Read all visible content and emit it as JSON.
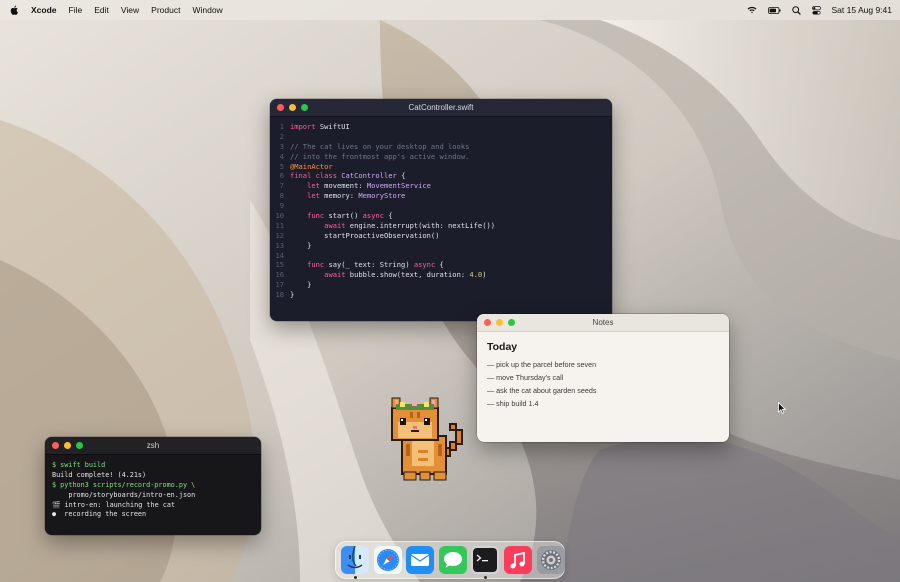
{
  "menubar": {
    "app_name": "Xcode",
    "items": [
      "File",
      "Edit",
      "View",
      "Product",
      "Window"
    ],
    "clock": "Sat 15 Aug 9:41",
    "status_icons": [
      "wifi-icon",
      "battery-icon",
      "search-icon",
      "control-center-icon"
    ]
  },
  "editor": {
    "title": "CatController.swift",
    "lines": [
      {
        "n": "1",
        "tokens": [
          [
            "kw",
            "import"
          ],
          [
            "tx",
            " SwiftUI"
          ]
        ]
      },
      {
        "n": "2",
        "tokens": []
      },
      {
        "n": "3",
        "tokens": [
          [
            "cm",
            "// The cat lives on your desktop and looks"
          ]
        ]
      },
      {
        "n": "4",
        "tokens": [
          [
            "cm",
            "// into the frontmost app's active window."
          ]
        ]
      },
      {
        "n": "5",
        "tokens": [
          [
            "at",
            "@MainActor"
          ]
        ]
      },
      {
        "n": "6",
        "tokens": [
          [
            "kw",
            "final class"
          ],
          [
            "tx",
            " "
          ],
          [
            "ty",
            "CatController"
          ],
          [
            "tx",
            " {"
          ]
        ]
      },
      {
        "n": "7",
        "tokens": [
          [
            "tx",
            "    "
          ],
          [
            "kw",
            "let"
          ],
          [
            "tx",
            " movement: "
          ],
          [
            "ty",
            "MovementService"
          ]
        ]
      },
      {
        "n": "8",
        "tokens": [
          [
            "tx",
            "    "
          ],
          [
            "kw",
            "let"
          ],
          [
            "tx",
            " memory: "
          ],
          [
            "ty",
            "MemoryStore"
          ]
        ]
      },
      {
        "n": "9",
        "tokens": []
      },
      {
        "n": "10",
        "tokens": [
          [
            "tx",
            "    "
          ],
          [
            "kw",
            "func"
          ],
          [
            "tx",
            " start() "
          ],
          [
            "kw",
            "async"
          ],
          [
            "tx",
            " {"
          ]
        ]
      },
      {
        "n": "11",
        "tokens": [
          [
            "tx",
            "        "
          ],
          [
            "kw",
            "await"
          ],
          [
            "tx",
            " engine.interrupt(with: nextLife())"
          ]
        ]
      },
      {
        "n": "12",
        "tokens": [
          [
            "tx",
            "        startProactiveObservation()"
          ]
        ]
      },
      {
        "n": "13",
        "tokens": [
          [
            "tx",
            "    }"
          ]
        ]
      },
      {
        "n": "14",
        "tokens": []
      },
      {
        "n": "15",
        "tokens": [
          [
            "tx",
            "    "
          ],
          [
            "kw",
            "func"
          ],
          [
            "tx",
            " say(_ text: String) "
          ],
          [
            "kw",
            "async"
          ],
          [
            "tx",
            " {"
          ]
        ]
      },
      {
        "n": "16",
        "tokens": [
          [
            "tx",
            "        "
          ],
          [
            "kw",
            "await"
          ],
          [
            "tx",
            " bubble.show(text, duration: "
          ],
          [
            "nm",
            "4.0"
          ],
          [
            "tx",
            ")"
          ]
        ]
      },
      {
        "n": "17",
        "tokens": [
          [
            "tx",
            "    }"
          ]
        ]
      },
      {
        "n": "18",
        "tokens": [
          [
            "tx",
            "}"
          ]
        ]
      }
    ]
  },
  "notes": {
    "title": "Notes",
    "heading": "Today",
    "items": [
      "— pick up the parcel before seven",
      "— move Thursday's call",
      "— ask the cat about garden seeds",
      "— ship build 1.4"
    ]
  },
  "terminal": {
    "title": "zsh",
    "lines": [
      {
        "kind": "prompt",
        "text": "$ swift build"
      },
      {
        "kind": "out",
        "text": "Build complete! (4.21s)"
      },
      {
        "kind": "prompt",
        "text": "$ python3 scripts/record-promo.py \\"
      },
      {
        "kind": "out",
        "text": "    promo/storyboards/intro-en.json"
      },
      {
        "kind": "out",
        "text": "🎬 intro-en: launching the cat"
      },
      {
        "kind": "out",
        "text": "●  recording the screen"
      }
    ]
  },
  "dock": {
    "apps": [
      {
        "name": "finder-icon",
        "running": true
      },
      {
        "name": "safari-icon",
        "running": false
      },
      {
        "name": "mail-icon",
        "running": false
      },
      {
        "name": "messages-icon",
        "running": false
      },
      {
        "name": "terminal-icon",
        "running": true
      },
      {
        "name": "music-icon",
        "running": false
      },
      {
        "name": "settings-icon",
        "running": false
      }
    ]
  },
  "desktop_pet": "pixel-cat-icon"
}
